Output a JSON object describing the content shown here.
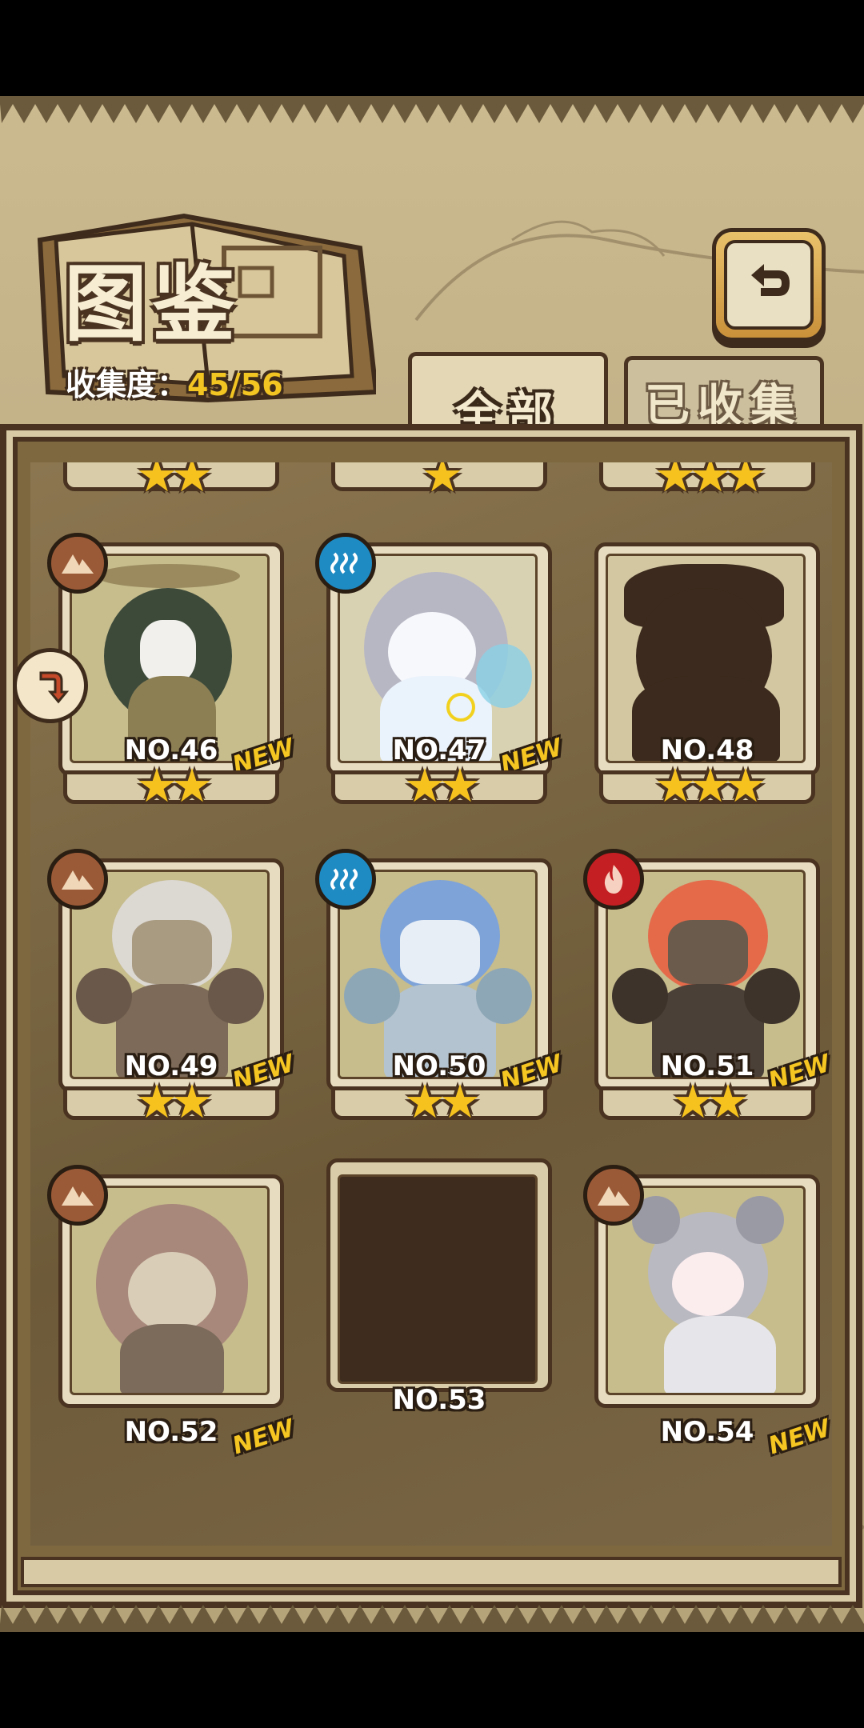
{
  "header": {
    "title": "图鉴",
    "progress_label": "收集度：",
    "progress_value": "45/56"
  },
  "tabs": [
    {
      "label": "全部",
      "active": true
    },
    {
      "label": "已收集",
      "active": false
    }
  ],
  "icons": {
    "back": "back-arrow-icon",
    "sort": "sort-icon",
    "earth": "earth-element-icon",
    "water": "water-element-icon",
    "fire": "fire-element-icon"
  },
  "partial_row": [
    {
      "stars": "★★"
    },
    {
      "stars": "★"
    },
    {
      "stars": "★★★"
    }
  ],
  "cards": [
    {
      "number": "NO.46",
      "element": "earth",
      "stars": "★★",
      "new": "NEW",
      "state": "unlocked",
      "colors": {
        "hair": "#3d4a3a",
        "body": "#8c7f54"
      }
    },
    {
      "number": "NO.47",
      "element": "water",
      "stars": "★★",
      "new": "NEW",
      "state": "unlocked",
      "colors": {
        "hair": "#b7b7c4",
        "body": "#eaf2fb"
      }
    },
    {
      "number": "NO.48",
      "element": "",
      "stars": "★★★",
      "new": "",
      "state": "silhouette",
      "colors": {
        "hair": "#3b2a1d",
        "body": "#3b2a1d"
      }
    },
    {
      "number": "NO.49",
      "element": "earth",
      "stars": "★★",
      "new": "NEW",
      "state": "unlocked",
      "colors": {
        "hair": "#dcd8d2",
        "body": "#7d6a58"
      }
    },
    {
      "number": "NO.50",
      "element": "water",
      "stars": "★★",
      "new": "NEW",
      "state": "unlocked",
      "colors": {
        "hair": "#7ea3d8",
        "body": "#b3c3cf"
      }
    },
    {
      "number": "NO.51",
      "element": "fire",
      "stars": "★★",
      "new": "NEW",
      "state": "unlocked",
      "colors": {
        "hair": "#e46a4a",
        "body": "#4b4037"
      }
    },
    {
      "number": "NO.52",
      "element": "earth",
      "stars": "",
      "new": "NEW",
      "state": "unlocked",
      "colors": {
        "hair": "#a8887a",
        "body": "#7c6a5b"
      }
    },
    {
      "number": "NO.53",
      "element": "",
      "stars": "",
      "new": "",
      "state": "empty",
      "colors": {
        "hair": "#3e2c1e",
        "body": "#3e2c1e"
      }
    },
    {
      "number": "NO.54",
      "element": "earth",
      "stars": "",
      "new": "NEW",
      "state": "unlocked",
      "colors": {
        "hair": "#b9b9c1",
        "body": "#e6e6ea"
      }
    }
  ]
}
